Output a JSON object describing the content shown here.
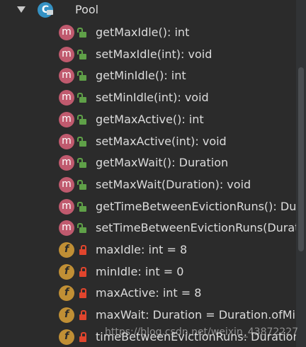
{
  "class_node": {
    "name": "Pool",
    "icon": "class-icon",
    "letter": "C"
  },
  "members": [
    {
      "kind": "method",
      "icon_letter": "m",
      "label": "getMaxIdle(): int"
    },
    {
      "kind": "method",
      "icon_letter": "m",
      "label": "setMaxIdle(int): void"
    },
    {
      "kind": "method",
      "icon_letter": "m",
      "label": "getMinIdle(): int"
    },
    {
      "kind": "method",
      "icon_letter": "m",
      "label": "setMinIdle(int): void"
    },
    {
      "kind": "method",
      "icon_letter": "m",
      "label": "getMaxActive(): int"
    },
    {
      "kind": "method",
      "icon_letter": "m",
      "label": "setMaxActive(int): void"
    },
    {
      "kind": "method",
      "icon_letter": "m",
      "label": "getMaxWait(): Duration"
    },
    {
      "kind": "method",
      "icon_letter": "m",
      "label": "setMaxWait(Duration): void"
    },
    {
      "kind": "method",
      "icon_letter": "m",
      "label": "getTimeBetweenEvictionRuns(): Dur"
    },
    {
      "kind": "method",
      "icon_letter": "m",
      "label": "setTimeBetweenEvictionRuns(Durat"
    },
    {
      "kind": "field",
      "icon_letter": "f",
      "label": "maxIdle: int = 8"
    },
    {
      "kind": "field",
      "icon_letter": "f",
      "label": "minIdle: int = 0"
    },
    {
      "kind": "field",
      "icon_letter": "f",
      "label": "maxActive: int = 8"
    },
    {
      "kind": "field",
      "icon_letter": "f",
      "label": "maxWait: Duration = Duration.ofMill"
    },
    {
      "kind": "field",
      "icon_letter": "f",
      "label": "timeBetweenEvictionRuns: Duration"
    }
  ],
  "watermark": "https://blog.csdn.net/weixin_43872227",
  "colors": {
    "background": "#2b2b2b",
    "method_icon": "#c05a6e",
    "field_icon": "#c08f35",
    "public_lock": "#5fa048",
    "private_lock": "#e0452d",
    "class_icon": "#3592c4"
  }
}
